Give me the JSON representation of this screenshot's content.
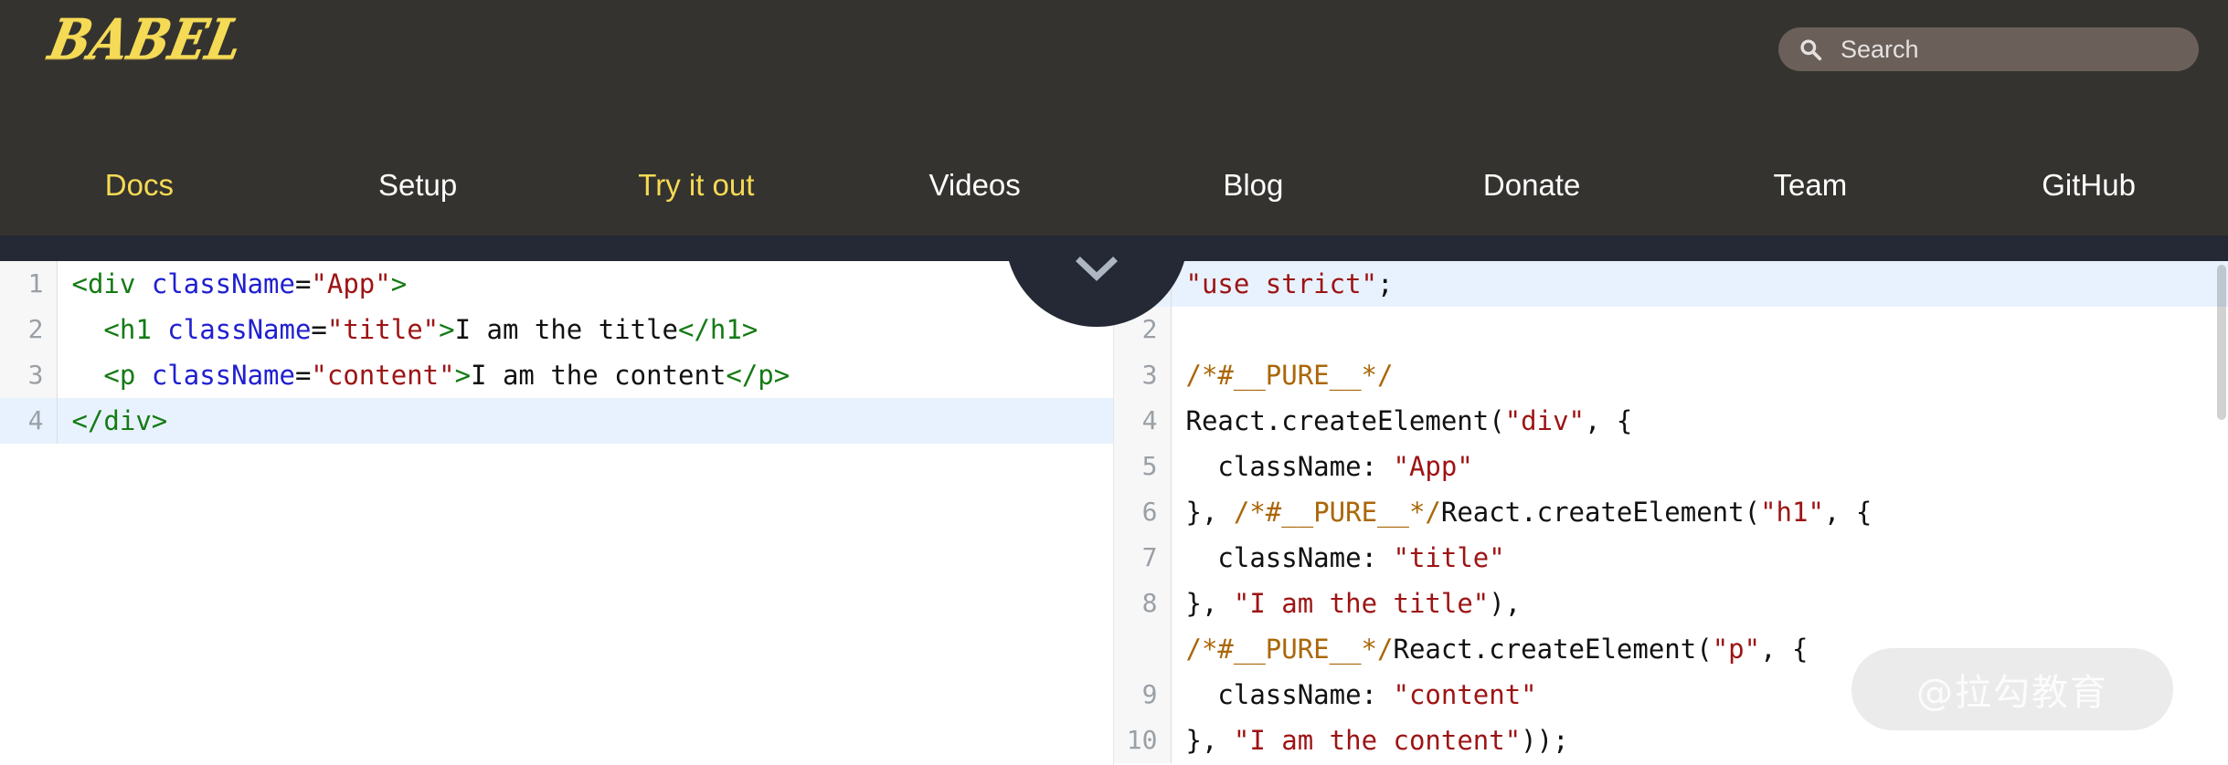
{
  "header": {
    "logo_text": "BABEL",
    "logo_color": "#f5da55",
    "background_color": "#34332f",
    "search": {
      "placeholder": "Search",
      "icon": "search-icon",
      "background_color": "#6b5f5a"
    }
  },
  "nav": {
    "accent_color": "#f5da55",
    "default_color": "#ffffff",
    "items": [
      {
        "label": "Docs",
        "accent": true
      },
      {
        "label": "Setup",
        "accent": false
      },
      {
        "label": "Try it out",
        "accent": true
      },
      {
        "label": "Videos",
        "accent": false
      },
      {
        "label": "Blog",
        "accent": false
      },
      {
        "label": "Donate",
        "accent": false
      },
      {
        "label": "Team",
        "accent": false
      },
      {
        "label": "GitHub",
        "accent": false
      }
    ]
  },
  "toggle_tab": {
    "icon": "chevron-down-icon",
    "background_color": "#242935",
    "icon_color": "#aeb6c4"
  },
  "editor_left": {
    "language": "jsx",
    "highlighted_line": 4,
    "lines": [
      {
        "number": "1",
        "tokens": [
          {
            "t": "<div",
            "c": "tag"
          },
          {
            "t": " ",
            "c": "plain"
          },
          {
            "t": "className",
            "c": "attr"
          },
          {
            "t": "=",
            "c": "punct"
          },
          {
            "t": "\"App\"",
            "c": "str"
          },
          {
            "t": ">",
            "c": "tag"
          }
        ]
      },
      {
        "number": "2",
        "tokens": [
          {
            "t": "  ",
            "c": "plain"
          },
          {
            "t": "<h1",
            "c": "tag"
          },
          {
            "t": " ",
            "c": "plain"
          },
          {
            "t": "className",
            "c": "attr"
          },
          {
            "t": "=",
            "c": "punct"
          },
          {
            "t": "\"title\"",
            "c": "str"
          },
          {
            "t": ">",
            "c": "tag"
          },
          {
            "t": "I am the title",
            "c": "plain"
          },
          {
            "t": "</h1>",
            "c": "tag"
          }
        ]
      },
      {
        "number": "3",
        "tokens": [
          {
            "t": "  ",
            "c": "plain"
          },
          {
            "t": "<p",
            "c": "tag"
          },
          {
            "t": " ",
            "c": "plain"
          },
          {
            "t": "className",
            "c": "attr"
          },
          {
            "t": "=",
            "c": "punct"
          },
          {
            "t": "\"content\"",
            "c": "str"
          },
          {
            "t": ">",
            "c": "tag"
          },
          {
            "t": "I am the content",
            "c": "plain"
          },
          {
            "t": "</p>",
            "c": "tag"
          }
        ]
      },
      {
        "number": "4",
        "tokens": [
          {
            "t": "</div>",
            "c": "tag"
          }
        ]
      }
    ]
  },
  "editor_right": {
    "language": "javascript",
    "highlighted_line": 1,
    "lines": [
      {
        "number": "1",
        "tokens": [
          {
            "t": "\"use strict\"",
            "c": "str"
          },
          {
            "t": ";",
            "c": "punct"
          }
        ]
      },
      {
        "number": "2",
        "tokens": []
      },
      {
        "number": "3",
        "tokens": [
          {
            "t": "/*#__PURE__*/",
            "c": "comment"
          }
        ]
      },
      {
        "number": "4",
        "tokens": [
          {
            "t": "React.createElement(",
            "c": "plain"
          },
          {
            "t": "\"div\"",
            "c": "str"
          },
          {
            "t": ", {",
            "c": "plain"
          }
        ]
      },
      {
        "number": "5",
        "tokens": [
          {
            "t": "  className: ",
            "c": "plain"
          },
          {
            "t": "\"App\"",
            "c": "str"
          }
        ]
      },
      {
        "number": "6",
        "tokens": [
          {
            "t": "}, ",
            "c": "plain"
          },
          {
            "t": "/*#__PURE__*/",
            "c": "comment"
          },
          {
            "t": "React.createElement(",
            "c": "plain"
          },
          {
            "t": "\"h1\"",
            "c": "str"
          },
          {
            "t": ", {",
            "c": "plain"
          }
        ]
      },
      {
        "number": "7",
        "tokens": [
          {
            "t": "  className: ",
            "c": "plain"
          },
          {
            "t": "\"title\"",
            "c": "str"
          }
        ]
      },
      {
        "number": "8",
        "tokens": [
          {
            "t": "}, ",
            "c": "plain"
          },
          {
            "t": "\"I am the title\"",
            "c": "str"
          },
          {
            "t": "),",
            "c": "plain"
          }
        ]
      },
      {
        "number": "",
        "tokens": [
          {
            "t": "/*#__PURE__*/",
            "c": "comment"
          },
          {
            "t": "React.createElement(",
            "c": "plain"
          },
          {
            "t": "\"p\"",
            "c": "str"
          },
          {
            "t": ", {",
            "c": "plain"
          }
        ]
      },
      {
        "number": "9",
        "tokens": [
          {
            "t": "  className: ",
            "c": "plain"
          },
          {
            "t": "\"content\"",
            "c": "str"
          }
        ]
      },
      {
        "number": "10",
        "tokens": [
          {
            "t": "}, ",
            "c": "plain"
          },
          {
            "t": "\"I am the content\"",
            "c": "str"
          },
          {
            "t": "));",
            "c": "plain"
          }
        ]
      }
    ]
  },
  "watermark": {
    "text": "@拉勾教育"
  }
}
